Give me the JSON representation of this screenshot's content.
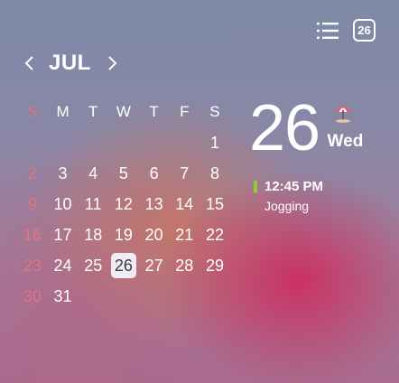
{
  "header": {
    "list_icon": "list-view-icon",
    "today_badge": "26"
  },
  "nav": {
    "month": "JUL",
    "prev_icon": "chevron-left-icon",
    "next_icon": "chevron-right-icon"
  },
  "calendar": {
    "weekdays": [
      "S",
      "M",
      "T",
      "W",
      "T",
      "F",
      "S"
    ],
    "days": [
      "",
      "",
      "",
      "",
      "",
      "",
      "1",
      "2",
      "3",
      "4",
      "5",
      "6",
      "7",
      "8",
      "9",
      "10",
      "11",
      "12",
      "13",
      "14",
      "15",
      "16",
      "17",
      "18",
      "19",
      "20",
      "21",
      "22",
      "23",
      "24",
      "25",
      "26",
      "27",
      "28",
      "29",
      "30",
      "31",
      "",
      "",
      "",
      "",
      ""
    ],
    "today": "26"
  },
  "selected": {
    "day": "26",
    "weekday": "Wed",
    "weather_icon": "beach-umbrella-icon"
  },
  "event": {
    "time": "12:45 PM",
    "title": "Jogging",
    "color": "#8ec94b"
  },
  "colors": {
    "sunday": "#e07480",
    "today_highlight": "#f1ecf1"
  }
}
